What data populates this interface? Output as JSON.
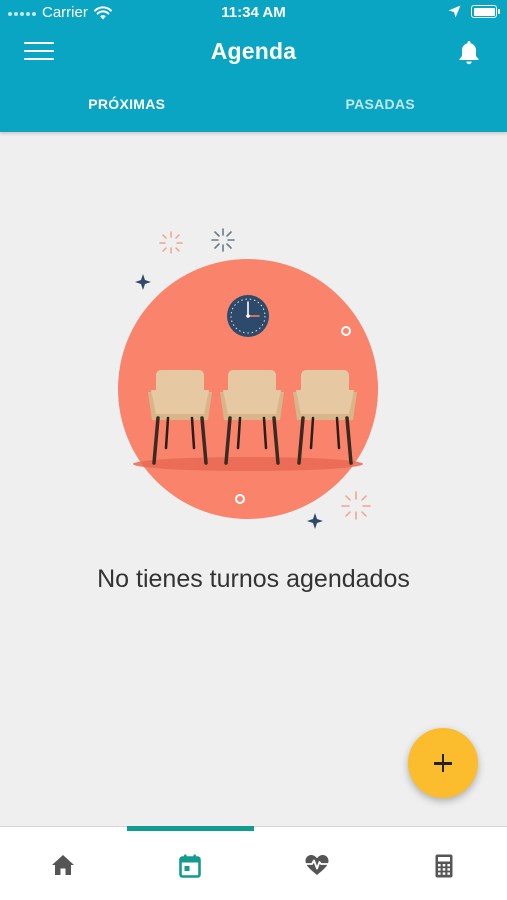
{
  "status_bar": {
    "carrier": "Carrier",
    "time": "11:34 AM",
    "battery_level": 1.0
  },
  "app_bar": {
    "title": "Agenda",
    "menu_icon": "hamburger-menu-icon",
    "notification_icon": "bell-icon"
  },
  "tabs": [
    {
      "label": "PRÓXIMAS",
      "active": true
    },
    {
      "label": "PASADAS",
      "active": false
    }
  ],
  "empty_state": {
    "message": "No tienes turnos agendados",
    "illustration": "waiting-room-chairs-illustration"
  },
  "fab": {
    "icon": "plus-icon"
  },
  "bottom_nav": {
    "items": [
      {
        "icon": "home-icon",
        "active": false
      },
      {
        "icon": "calendar-icon",
        "active": true
      },
      {
        "icon": "heartbeat-icon",
        "active": false
      },
      {
        "icon": "calculator-icon",
        "active": false
      }
    ]
  },
  "colors": {
    "primary": "#0aa5c3",
    "accent": "#fbbd2e",
    "active_nav": "#119c8f",
    "inactive_nav": "#555555",
    "illustration_circle": "#f9836b",
    "chair": "#e5c9a3",
    "clock": "#2e4a6b"
  }
}
